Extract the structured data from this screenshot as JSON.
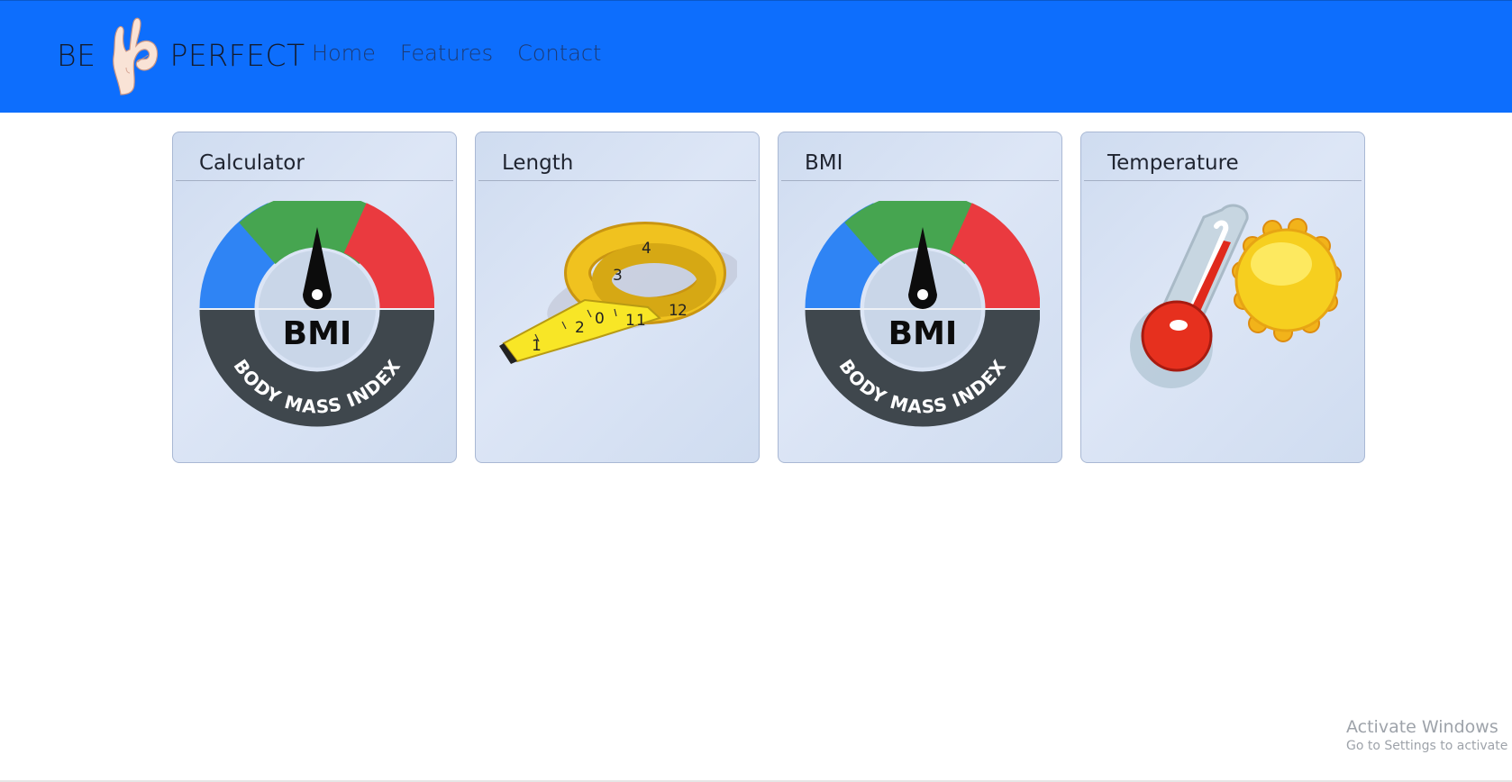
{
  "navbar": {
    "brand": {
      "left_text": "BE",
      "right_text": "PERFECT",
      "icon": "ok-hand-icon"
    },
    "links": [
      {
        "label": "Home"
      },
      {
        "label": "Features"
      },
      {
        "label": "Contact"
      }
    ]
  },
  "cards": [
    {
      "title": "Calculator",
      "icon": "bmi-gauge-icon",
      "image_text": {
        "top": "BMI",
        "ring": "BODY MASS INDEX"
      }
    },
    {
      "title": "Length",
      "icon": "measuring-tape-icon",
      "image_text": {
        "marks": [
          "1",
          "2",
          "3",
          "0",
          "1",
          "1",
          "1",
          "2",
          "4"
        ]
      }
    },
    {
      "title": "BMI",
      "icon": "bmi-gauge-icon",
      "image_text": {
        "top": "BMI",
        "ring": "BODY MASS INDEX"
      }
    },
    {
      "title": "Temperature",
      "icon": "thermometer-sun-icon"
    }
  ],
  "watermark": {
    "title": "Activate Windows",
    "subtitle": "Go to Settings to activate Windows."
  },
  "colors": {
    "navbar": "#0d6efd",
    "card_bg": "#d6e1f3",
    "gauge_blue": "#2f84f4",
    "gauge_green": "#46a550",
    "gauge_red": "#ea3a3f",
    "gauge_band": "#3f474d"
  }
}
